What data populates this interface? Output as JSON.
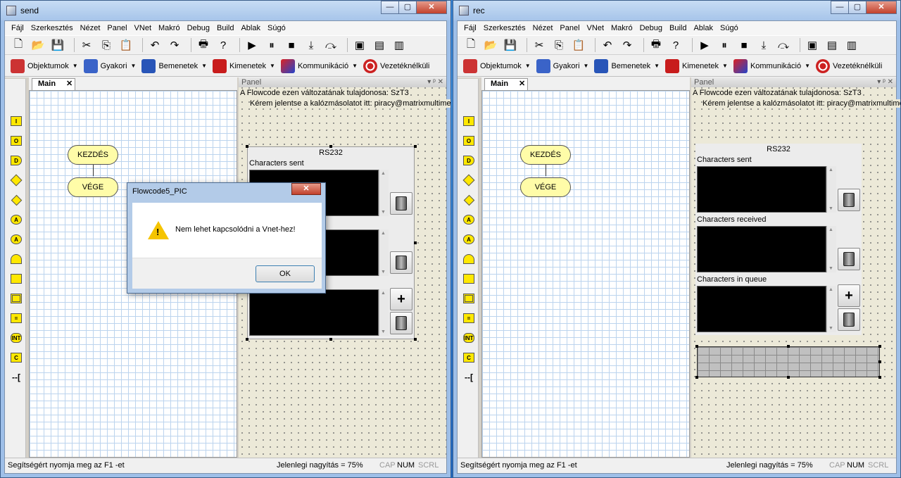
{
  "window_send": {
    "title": "send",
    "dialog": {
      "title": "Flowcode5_PIC",
      "close": "✕",
      "message": "Nem lehet kapcsolódni a Vnet-hez!",
      "ok": "OK"
    }
  },
  "window_rec": {
    "title": "rec"
  },
  "window_controls": {
    "min": "—",
    "max": "▢",
    "close": "✕"
  },
  "menu": [
    "Fájl",
    "Szerkesztés",
    "Nézet",
    "Panel",
    "VNet",
    "Makró",
    "Debug",
    "Build",
    "Ablak",
    "Súgó"
  ],
  "categories": [
    "Objektumok",
    "Gyakori",
    "Bemenetek",
    "Kimenetek",
    "Kommunikáció",
    "Vezetéknélküli"
  ],
  "tab": {
    "label": "Main",
    "close": "✕"
  },
  "flowchart": {
    "start": "KEZDÉS",
    "end": "VÉGE"
  },
  "panel": {
    "title": "Panel",
    "controls": "▾ ᵖ ✕",
    "owner_note": "A Flowcode ezen változatának tulajdonosa: SzT3",
    "piracy_note": "Kérem jelentse a kalózmásolatot itt: piracy@matrixmultimedia.co",
    "rs232_title": "RS232",
    "characters_sent": "Characters sent",
    "characters_received": "Characters received",
    "characters_in_queue": "Characters in queue",
    "plus": "+"
  },
  "icon_tools": [
    "I",
    "O",
    "D",
    "",
    "",
    "A",
    "A",
    "",
    "",
    "",
    "",
    "INT",
    "C",
    "--["
  ],
  "status": {
    "help": "Segítségért nyomja meg az F1 -et",
    "zoom": "Jelenlegi nagyítás = 75%",
    "cap": "CAP",
    "num": "NUM",
    "scrl": "SCRL"
  },
  "colors": {
    "flow_block": "#fffca8",
    "grid_line": "#bcd4ee",
    "panel_bg": "#ece9d8",
    "warning": "#f5c400"
  }
}
